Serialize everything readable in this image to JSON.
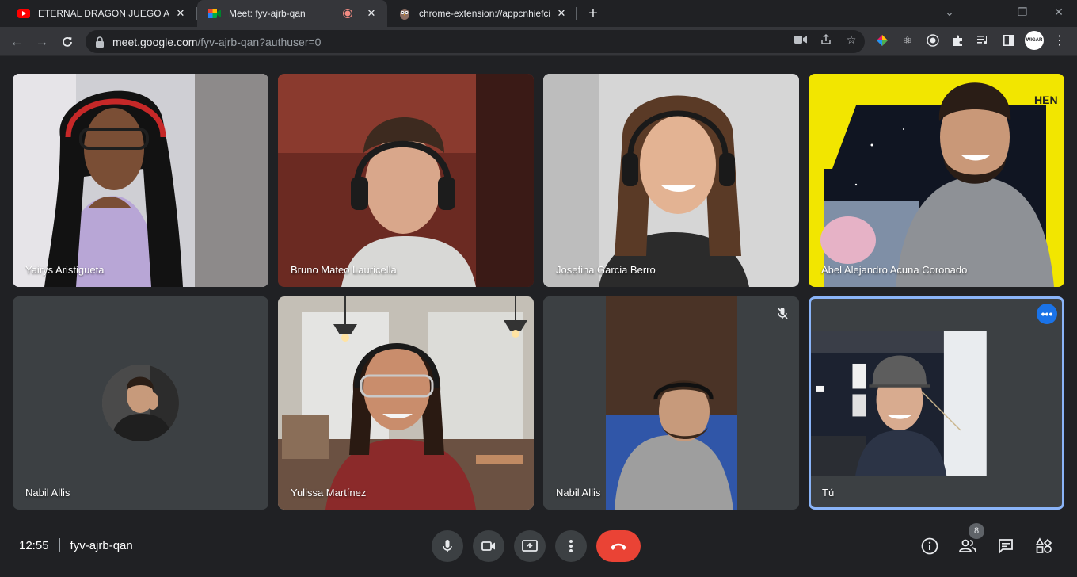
{
  "browser": {
    "tabs": [
      {
        "title": "ETERNAL DRAGON JUEGO AAA+",
        "favicon": "youtube-icon",
        "active": false
      },
      {
        "title": "Meet: fyv-ajrb-qan",
        "favicon": "meet-icon",
        "active": true,
        "recording": true
      },
      {
        "title": "chrome-extension://appcnhiefcid",
        "favicon": "owl-icon",
        "active": false
      }
    ],
    "url_host": "meet.google.com",
    "url_path": "/fyv-ajrb-qan?authuser=0",
    "profile_label": "WIGAR"
  },
  "participants": [
    {
      "name": "Yairys Aristigueta"
    },
    {
      "name": "Bruno Mateo Lauricella"
    },
    {
      "name": "Josefina Garcia Berro"
    },
    {
      "name": "Abel Alejandro Acuna Coronado"
    },
    {
      "name": "Nabil Allis"
    },
    {
      "name": "Yulissa Martínez"
    },
    {
      "name": "Nabil Allis",
      "muted": true
    },
    {
      "name": "Tú",
      "self": true
    }
  ],
  "meeting": {
    "time": "12:55",
    "code": "fyv-ajrb-qan",
    "people_count": "8"
  },
  "colors": {
    "background": "#202124",
    "tile": "#3c4043",
    "hangup": "#ea4335",
    "self_border": "#8ab4f8",
    "accent_blue": "#1a73e8"
  }
}
